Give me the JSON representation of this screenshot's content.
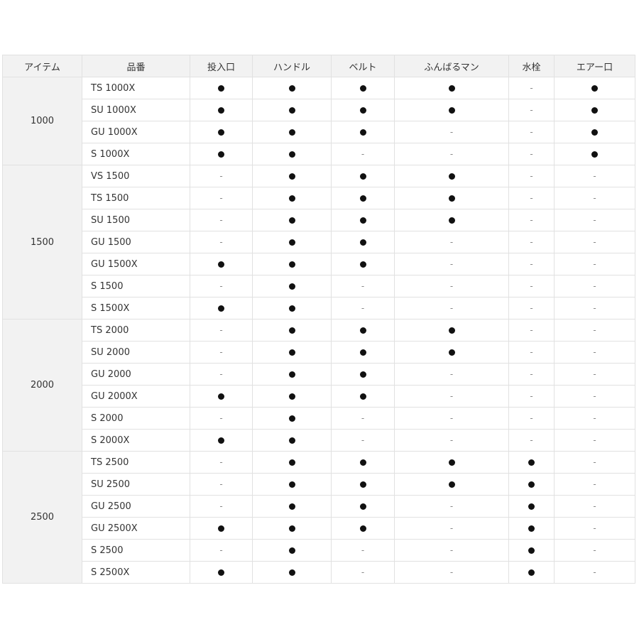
{
  "table": {
    "columns": [
      "アイテム",
      "品番",
      "投入口",
      "ハンドル",
      "ベルト",
      "ふんばるマン",
      "水栓",
      "エアー口"
    ],
    "yes_symbol": "●",
    "no_symbol": "-",
    "groups": [
      {
        "item": "1000",
        "rows": [
          {
            "model": "TS 1000X",
            "flags": [
              1,
              1,
              1,
              1,
              0,
              1
            ]
          },
          {
            "model": "SU 1000X",
            "flags": [
              1,
              1,
              1,
              1,
              0,
              1
            ]
          },
          {
            "model": "GU 1000X",
            "flags": [
              1,
              1,
              1,
              0,
              0,
              1
            ]
          },
          {
            "model": "S 1000X",
            "flags": [
              1,
              1,
              0,
              0,
              0,
              1
            ]
          }
        ]
      },
      {
        "item": "1500",
        "rows": [
          {
            "model": "VS 1500",
            "flags": [
              0,
              1,
              1,
              1,
              0,
              0
            ]
          },
          {
            "model": "TS 1500",
            "flags": [
              0,
              1,
              1,
              1,
              0,
              0
            ]
          },
          {
            "model": "SU 1500",
            "flags": [
              0,
              1,
              1,
              1,
              0,
              0
            ]
          },
          {
            "model": "GU 1500",
            "flags": [
              0,
              1,
              1,
              0,
              0,
              0
            ]
          },
          {
            "model": "GU 1500X",
            "flags": [
              1,
              1,
              1,
              0,
              0,
              0
            ]
          },
          {
            "model": "S 1500",
            "flags": [
              0,
              1,
              0,
              0,
              0,
              0
            ]
          },
          {
            "model": "S 1500X",
            "flags": [
              1,
              1,
              0,
              0,
              0,
              0
            ]
          }
        ]
      },
      {
        "item": "2000",
        "rows": [
          {
            "model": "TS 2000",
            "flags": [
              0,
              1,
              1,
              1,
              0,
              0
            ]
          },
          {
            "model": "SU 2000",
            "flags": [
              0,
              1,
              1,
              1,
              0,
              0
            ]
          },
          {
            "model": "GU 2000",
            "flags": [
              0,
              1,
              1,
              0,
              0,
              0
            ]
          },
          {
            "model": "GU 2000X",
            "flags": [
              1,
              1,
              1,
              0,
              0,
              0
            ]
          },
          {
            "model": "S 2000",
            "flags": [
              0,
              1,
              0,
              0,
              0,
              0
            ]
          },
          {
            "model": "S 2000X",
            "flags": [
              1,
              1,
              0,
              0,
              0,
              0
            ]
          }
        ]
      },
      {
        "item": "2500",
        "rows": [
          {
            "model": "TS 2500",
            "flags": [
              0,
              1,
              1,
              1,
              1,
              0
            ]
          },
          {
            "model": "SU 2500",
            "flags": [
              0,
              1,
              1,
              1,
              1,
              0
            ]
          },
          {
            "model": "GU 2500",
            "flags": [
              0,
              1,
              1,
              0,
              1,
              0
            ]
          },
          {
            "model": "GU 2500X",
            "flags": [
              1,
              1,
              1,
              0,
              1,
              0
            ]
          },
          {
            "model": "S 2500",
            "flags": [
              0,
              1,
              0,
              0,
              1,
              0
            ]
          },
          {
            "model": "S 2500X",
            "flags": [
              1,
              1,
              0,
              0,
              1,
              0
            ]
          }
        ]
      }
    ]
  }
}
